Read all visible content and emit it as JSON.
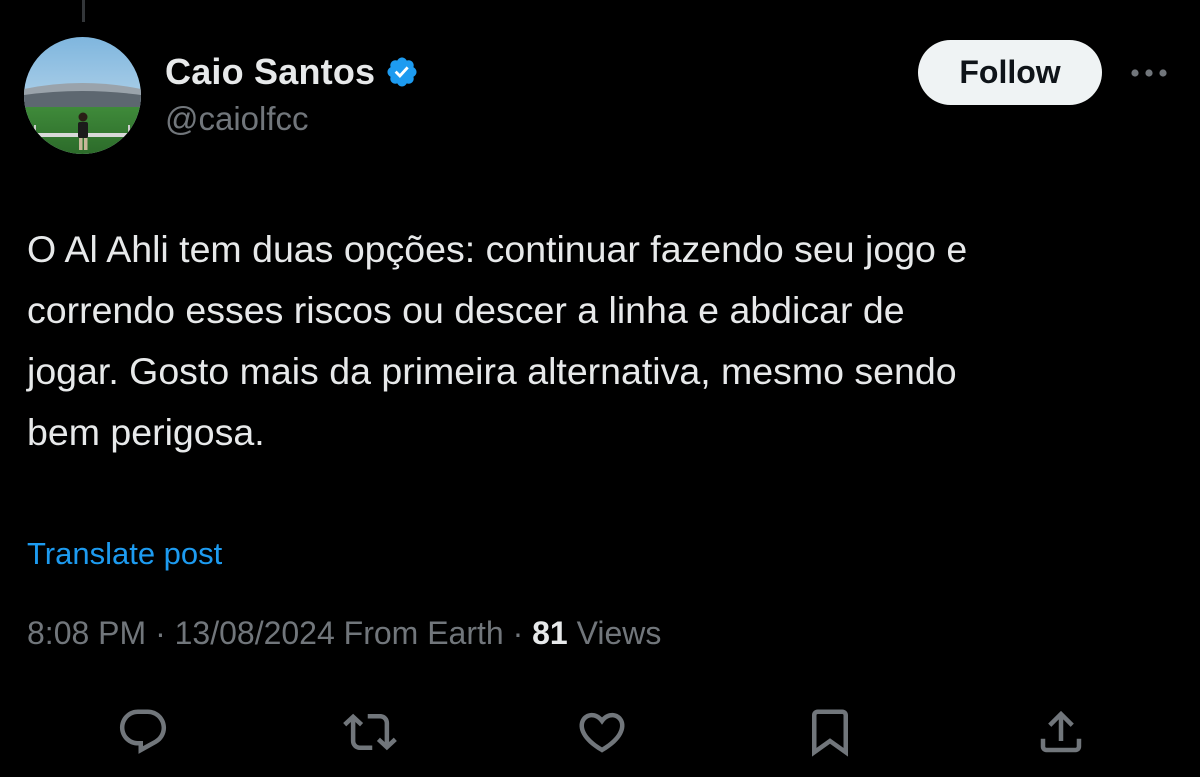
{
  "tweet": {
    "author": {
      "display_name": "Caio Santos",
      "handle": "@caiolfcc",
      "verified": true
    },
    "follow_label": "Follow",
    "text": "O Al Ahli tem duas opções: continuar fazendo seu jogo e\ncorrendo esses riscos ou descer a linha e abdicar de\njogar. Gosto mais da primeira alternativa, mesmo sendo\nbem perigosa.",
    "translate_label": "Translate post",
    "meta": {
      "time": "8:08 PM",
      "separator": " · ",
      "date": "13/08/2024",
      "source": "From Earth",
      "views_count": "81",
      "views_label": "Views"
    },
    "actions": {
      "icons": [
        "reply-icon",
        "retweet-icon",
        "like-icon",
        "bookmark-icon",
        "share-icon"
      ]
    }
  },
  "colors": {
    "background": "#000000",
    "text_primary": "#e7e9ea",
    "text_secondary": "#71767b",
    "accent": "#1d9bf0",
    "follow_bg": "#eff3f4"
  }
}
